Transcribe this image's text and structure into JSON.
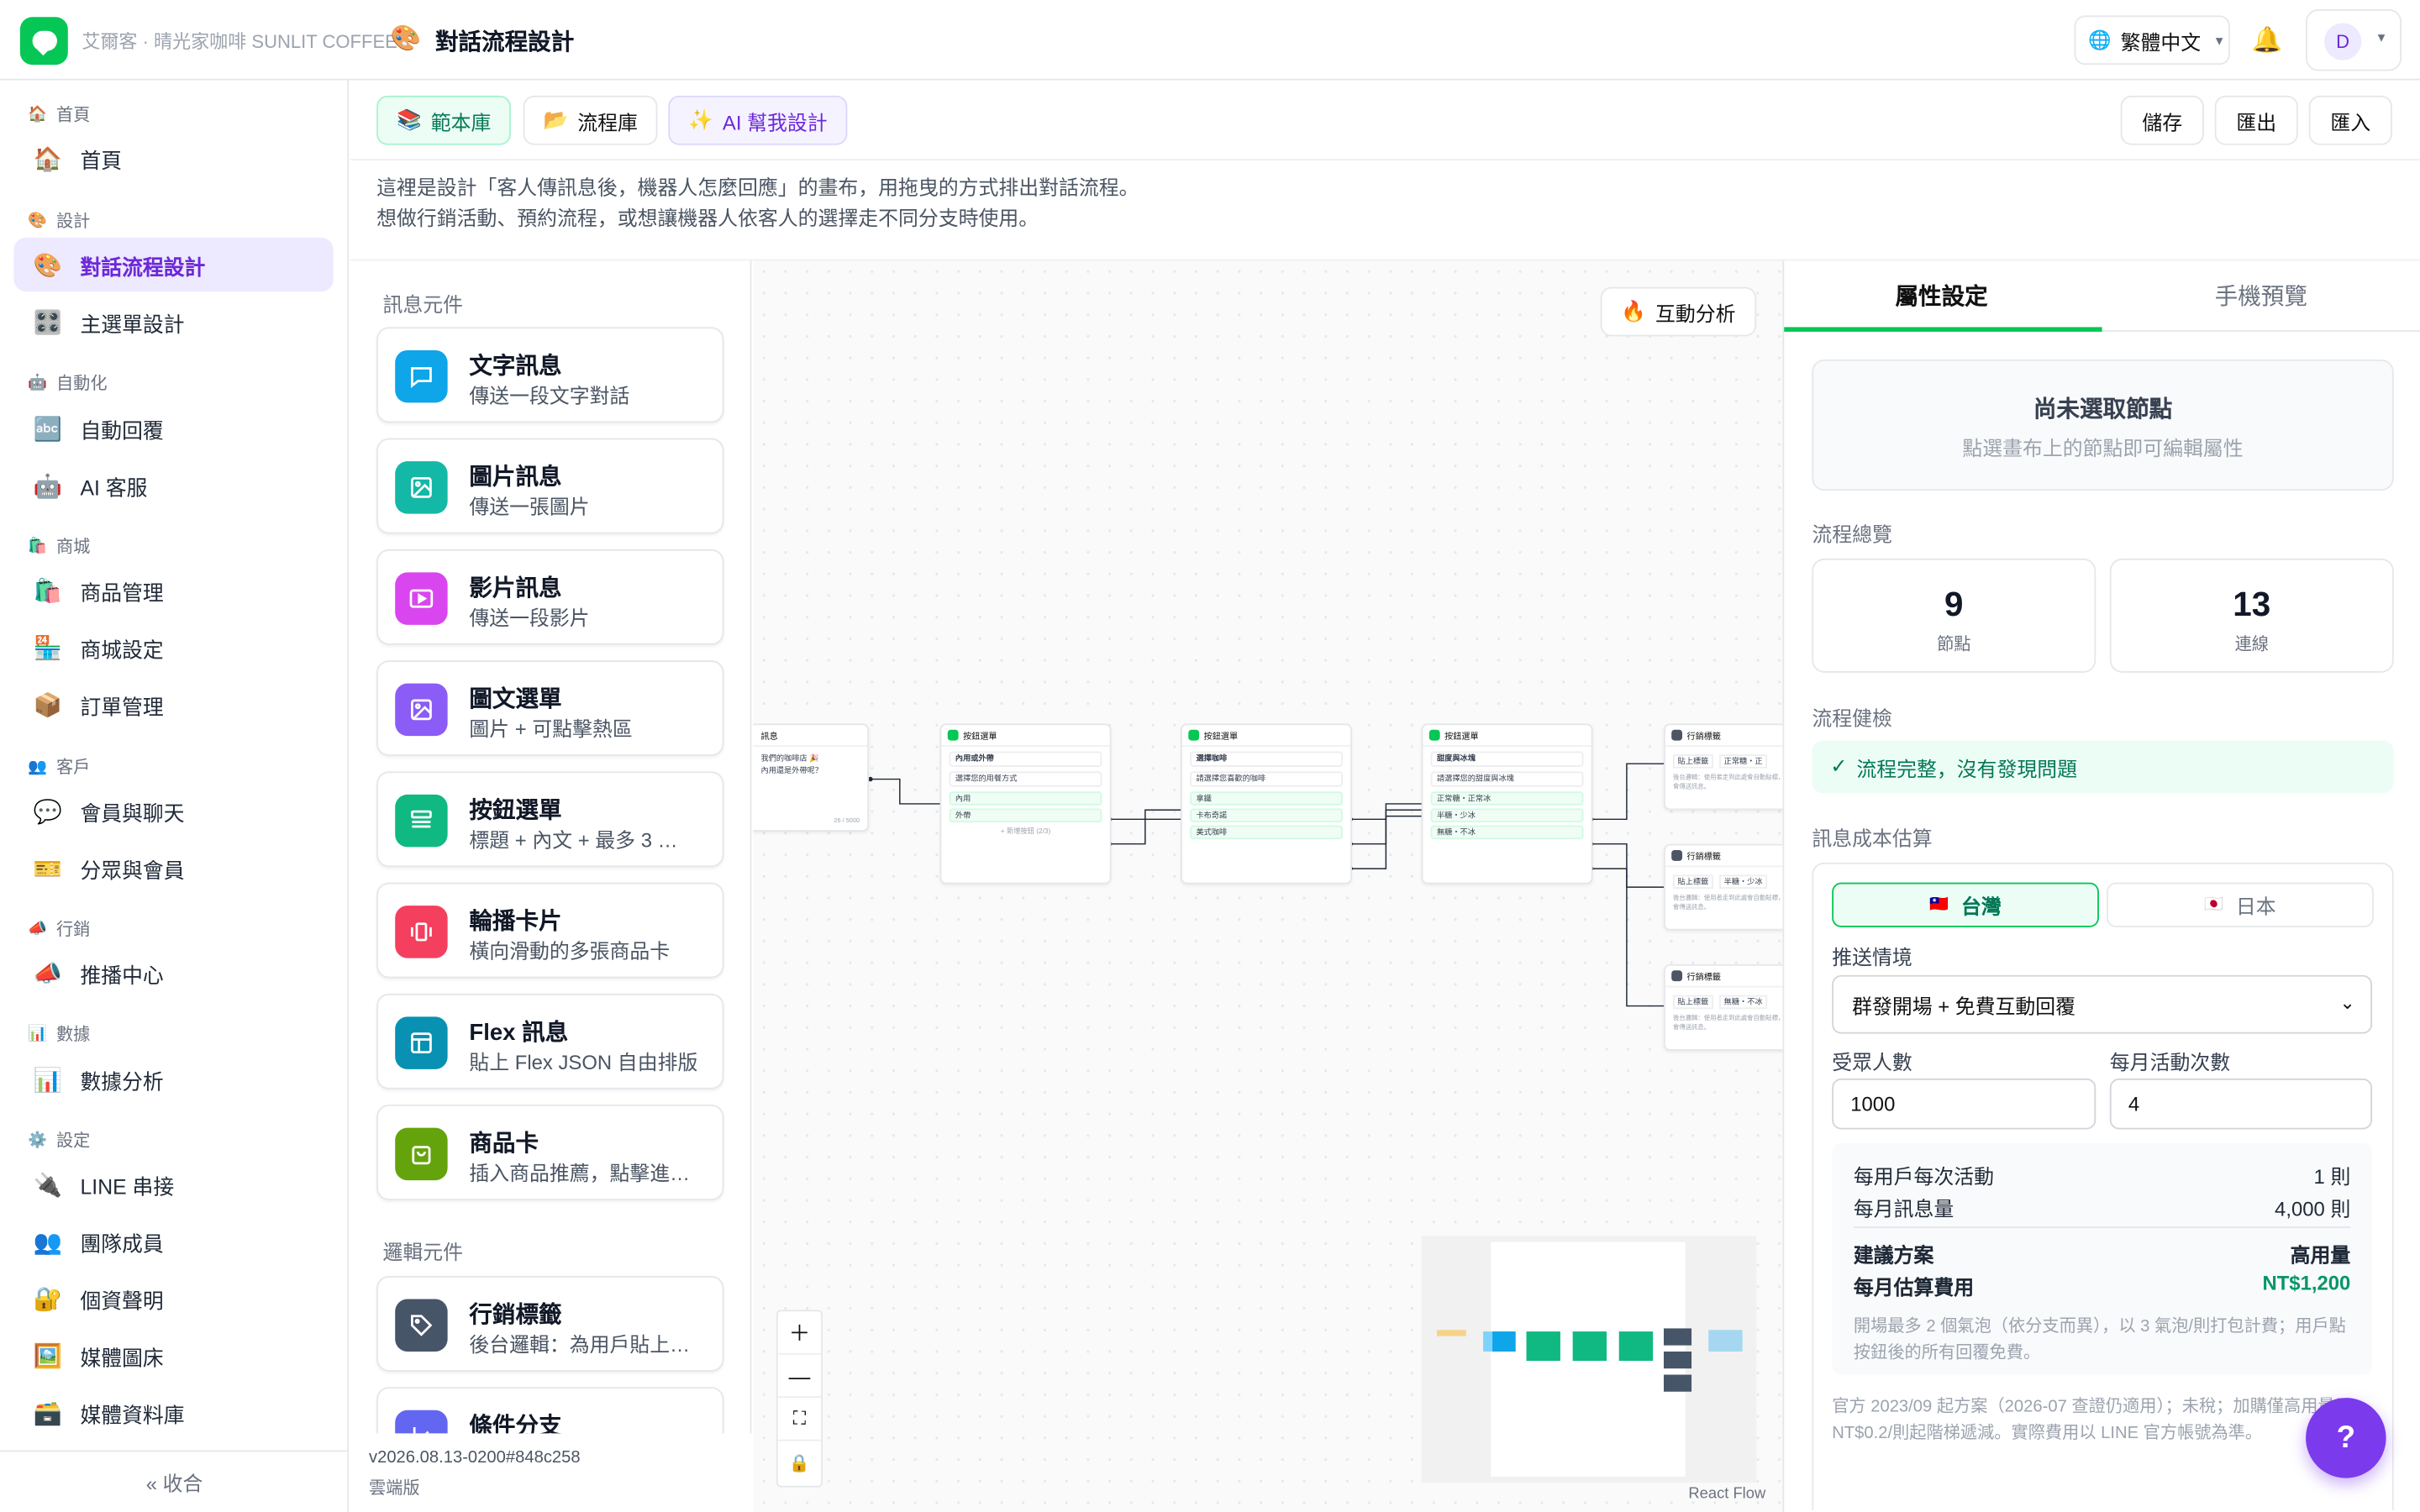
{
  "header": {
    "org": "艾爾客 · 晴光家咖啡 SUNLIT COFFEE",
    "title": "對話流程設計",
    "language": "繁體中文",
    "avatar": "D"
  },
  "sidebar": {
    "sections": [
      {
        "label": "首頁"
      },
      {
        "label": "設計"
      },
      {
        "label": "自動化"
      },
      {
        "label": "商城"
      },
      {
        "label": "客戶"
      },
      {
        "label": "行銷"
      },
      {
        "label": "數據"
      },
      {
        "label": "設定"
      }
    ],
    "items": [
      {
        "label": "首頁",
        "icon": "house-icon"
      },
      {
        "label": "對話流程設計",
        "icon": "palette-icon",
        "active": true
      },
      {
        "label": "主選單設計",
        "icon": "control-knobs-icon"
      },
      {
        "label": "自動回覆",
        "icon": "abc-icon"
      },
      {
        "label": "AI 客服",
        "icon": "robot-icon"
      },
      {
        "label": "商品管理",
        "icon": "shopping-bags-icon"
      },
      {
        "label": "商城設定",
        "icon": "shop-icon"
      },
      {
        "label": "訂單管理",
        "icon": "package-icon"
      },
      {
        "label": "會員與聊天",
        "icon": "speech-bubble-icon"
      },
      {
        "label": "分眾與會員",
        "icon": "ticket-icon"
      },
      {
        "label": "推播中心",
        "icon": "megaphone-icon"
      },
      {
        "label": "數據分析",
        "icon": "bar-chart-icon"
      },
      {
        "label": "LINE 串接",
        "icon": "plug-icon"
      },
      {
        "label": "團隊成員",
        "icon": "people-icon"
      },
      {
        "label": "個資聲明",
        "icon": "lock-icon"
      },
      {
        "label": "媒體圖床",
        "icon": "picture-icon"
      },
      {
        "label": "媒體資料庫",
        "icon": "box-icon"
      }
    ],
    "collapse": "« 收合"
  },
  "toolbar": {
    "template_lib": "範本庫",
    "flow_lib": "流程庫",
    "ai_design": "AI 幫我設計",
    "save": "儲存",
    "export": "匯出",
    "import": "匯入"
  },
  "description": {
    "line1": "這裡是設計「客人傳訊息後，機器人怎麼回應」的畫布，用拖曳的方式排出對話流程。",
    "line2": "想做行銷活動、預約流程，或想讓機器人依客人的選擇走不同分支時使用。"
  },
  "palette": {
    "message_section": "訊息元件",
    "logic_section": "邏輯元件",
    "messages": [
      {
        "title": "文字訊息",
        "subtitle": "傳送一段文字對話",
        "color": "#0ea5e9",
        "icon": "chat-icon"
      },
      {
        "title": "圖片訊息",
        "subtitle": "傳送一張圖片",
        "color": "#14b8a6",
        "icon": "image-icon"
      },
      {
        "title": "影片訊息",
        "subtitle": "傳送一段影片",
        "color": "#d946ef",
        "icon": "video-icon"
      },
      {
        "title": "圖文選單",
        "subtitle": "圖片 + 可點擊熱區",
        "color": "#8b5cf6",
        "icon": "imagemap-icon"
      },
      {
        "title": "按鈕選單",
        "subtitle": "標題 + 內文 + 最多 3 …",
        "color": "#10b981",
        "icon": "buttons-icon"
      },
      {
        "title": "輪播卡片",
        "subtitle": "橫向滑動的多張商品卡",
        "color": "#f43f5e",
        "icon": "carousel-icon"
      },
      {
        "title": "Flex 訊息",
        "subtitle": "貼上 Flex JSON 自由排版",
        "color": "#0891b2",
        "icon": "layout-icon"
      },
      {
        "title": "商品卡",
        "subtitle": "插入商品推薦，點擊進…",
        "color": "#65a30d",
        "icon": "bag-icon"
      }
    ],
    "logic": [
      {
        "title": "行銷標籤",
        "subtitle": "後台邏輯：為用戶貼上…",
        "color": "#475569",
        "icon": "tag-icon"
      },
      {
        "title": "條件分支",
        "subtitle": "",
        "color": "#6366f1",
        "icon": "branch-icon"
      }
    ]
  },
  "version": {
    "build": "v2026.08.13-0200#848c258",
    "env": "雲端版"
  },
  "canvas": {
    "analytics_button": "互動分析",
    "react_flow": "React Flow",
    "nodes": [
      {
        "type": "訊息",
        "lines": [
          "我們的咖啡店 🎉",
          "內用還是外帶呢？"
        ],
        "counter": "26 / 5000"
      },
      {
        "type": "按鈕選單",
        "title": "內用或外帶",
        "text": "選擇您的用餐方式",
        "options": [
          "內用",
          "外帶"
        ],
        "add": "+ 新增按鈕 (2/3)"
      },
      {
        "type": "按鈕選單",
        "title": "選擇咖啡",
        "text": "請選擇您喜歡的咖啡",
        "options": [
          "拿鐵",
          "卡布奇諾",
          "美式咖啡"
        ]
      },
      {
        "type": "按鈕選單",
        "title": "甜度與冰塊",
        "text": "請選擇您的甜度與冰塊",
        "options": [
          "正常糖・正常冰",
          "半糖・少冰",
          "無糖・不冰"
        ]
      },
      {
        "type": "行銷標籤",
        "tag": "貼上標籤",
        "value": "正常糖・正",
        "note": "後台邏輯：使用者走到此處會自動貼標，不會傳送訊息。"
      },
      {
        "type": "行銷標籤",
        "tag": "貼上標籤",
        "value": "半糖・少冰",
        "note": "後台邏輯：使用者走到此處會自動貼標，不會傳送訊息。"
      },
      {
        "type": "行銷標籤",
        "tag": "貼上標籤",
        "value": "無糖・不冰",
        "note": "後台邏輯：使用者走到此處會自動貼標，不會傳送訊息。"
      }
    ]
  },
  "right_panel": {
    "tabs": [
      "屬性設定",
      "手機預覽"
    ],
    "empty_title": "尚未選取節點",
    "empty_hint": "點選畫布上的節點即可編輯屬性",
    "overview_label": "流程總覽",
    "nodes_count": "9",
    "nodes_label": "節點",
    "edges_count": "13",
    "edges_label": "連線",
    "health_label": "流程健檢",
    "health_status": "流程完整，沒有發現問題",
    "cost_label": "訊息成本估算",
    "regions": [
      "台灣",
      "日本"
    ],
    "scenario_label": "推送情境",
    "scenario_value": "群發開場 + 免費互動回覆",
    "audience_label": "受眾人數",
    "audience_value": "1000",
    "monthly_label": "每月活動次數",
    "monthly_value": "4",
    "per_user_label": "每用戶每次活動",
    "per_user_value": "1 則",
    "monthly_msgs_label": "每月訊息量",
    "monthly_msgs_value": "4,000 則",
    "plan_label": "建議方案",
    "plan_value": "高用量",
    "cost_est_label": "每月估算費用",
    "cost_est_value": "NT$1,200",
    "fineprint": "開場最多 2 個氣泡（依分支而異），以 3 氣泡/則打包計費；用戶點按鈕後的所有回覆免費。",
    "footnote": "官方 2023/09 起方案（2026-07 查證仍適用）；未稅；加購僅高用量用，NT$0.2/則起階梯遞減。實際費用以 LINE 官方帳號為準。"
  },
  "colors": {
    "accent": "#06c755",
    "brand_purple": "#7c3aed",
    "active_bg": "#ede9fe"
  },
  "help": "?"
}
